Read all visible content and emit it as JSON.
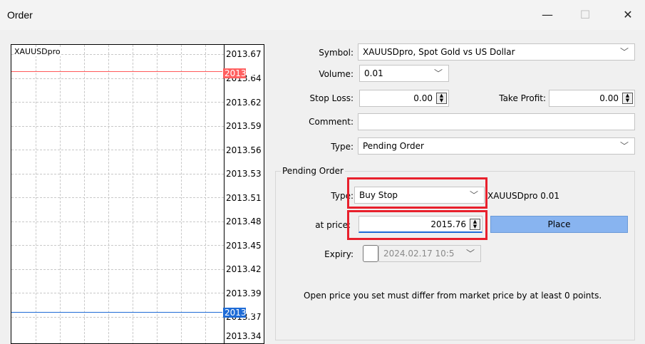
{
  "window": {
    "title": "Order",
    "minimize": "—",
    "maximize": "☐",
    "close": "✕"
  },
  "chart": {
    "symbol": "XAUUSDpro",
    "price_labels": [
      "2013.67",
      "2013.64",
      "2013.62",
      "2013.59",
      "2013.56",
      "2013.53",
      "2013.51",
      "2013.48",
      "2013.45",
      "2013.42",
      "2013.39",
      "2013.37",
      "2013.34"
    ],
    "ask": "2013.65",
    "bid": "2013.37",
    "ask_color": "#ff5a5a",
    "bid_color": "#1e6bd6"
  },
  "form": {
    "symbol_label": "Symbol:",
    "symbol_value": "XAUUSDpro, Spot Gold vs US Dollar",
    "volume_label": "Volume:",
    "volume_value": "0.01",
    "stoploss_label": "Stop Loss:",
    "stoploss_value": "0.00",
    "takeprofit_label": "Take Profit:",
    "takeprofit_value": "0.00",
    "comment_label": "Comment:",
    "comment_value": "",
    "type_label": "Type:",
    "type_value": "Pending Order"
  },
  "pending": {
    "group_title": "Pending Order",
    "type_label": "Type:",
    "type_value": "Buy Stop",
    "type_info": "XAUUSDpro 0.01",
    "price_label": "at price:",
    "price_value": "2015.76",
    "place_button": "Place",
    "expiry_label": "Expiry:",
    "expiry_value": "2024.02.17 10:5",
    "note": "Open price you set must differ from market price by at least 0 points."
  }
}
